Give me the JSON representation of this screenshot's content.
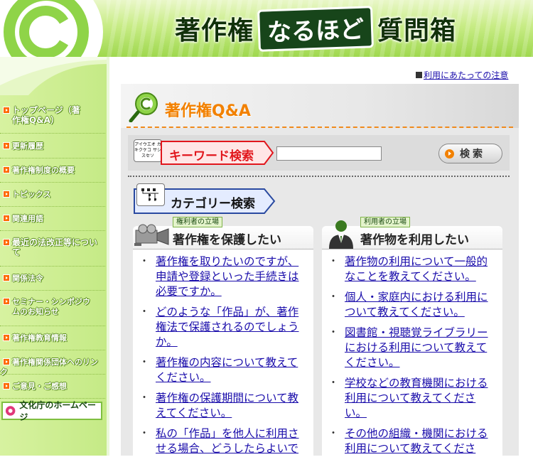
{
  "header": {
    "title_main": "著作権",
    "title_box": "なるほど",
    "title_sub": "質問箱"
  },
  "notice": {
    "link": "利用にあたっての注意"
  },
  "sidebar": {
    "items": [
      {
        "label": "トップページ（著作権Q&A）"
      },
      {
        "label": "更新履歴"
      },
      {
        "label": "著作権制度の概要"
      },
      {
        "label": "トピックス"
      },
      {
        "label": "関連用語"
      },
      {
        "label": "最近の法改正等について"
      },
      {
        "label": "関係法令"
      },
      {
        "label": "セミナー・シンポジウムのお知らせ"
      },
      {
        "label": "著作権教育情報"
      },
      {
        "label": "著作権関係団体へのリンク"
      },
      {
        "label": "ご意見・ご感想"
      }
    ],
    "bunka_link": "文化庁のホームページ"
  },
  "qa": {
    "title": "著作権Q&A"
  },
  "keyword_search": {
    "tag": "アイウエオ カキクケコ サシスセソ",
    "label": "キーワード検索",
    "input_value": "",
    "button": "検索"
  },
  "category_search": {
    "label": "カテゴリー検索"
  },
  "columns": {
    "left": {
      "badge": "権利者の立場",
      "title": "著作権を保護したい",
      "items": [
        "著作権を取りたいのですが、申請や登録といった手続きは必要ですか。",
        "どのような「作品」が、著作権法で保護されるのでしょうか。",
        "著作権の内容について教えてください。",
        "著作権の保護期間について教えてください。",
        "私の「作品」を他人に利用させる場合、どうしたらよいで"
      ]
    },
    "right": {
      "badge": "利用者の立場",
      "title": "著作物を利用したい",
      "items": [
        "著作物の利用について一般的なことを教えてください。",
        "個人・家庭内における利用について教えてください。",
        "図書館・視聴覚ライブラリーにおける利用について教えてください。",
        "学校などの教育機関における利用について教えてください。",
        "その他の組織・機関における利用について教えてくださ"
      ]
    }
  },
  "colors": {
    "brand_green": "#9fd84e",
    "accent_orange": "#f28100",
    "link_blue": "#1a0dab",
    "keyword_red": "#e1161c"
  }
}
